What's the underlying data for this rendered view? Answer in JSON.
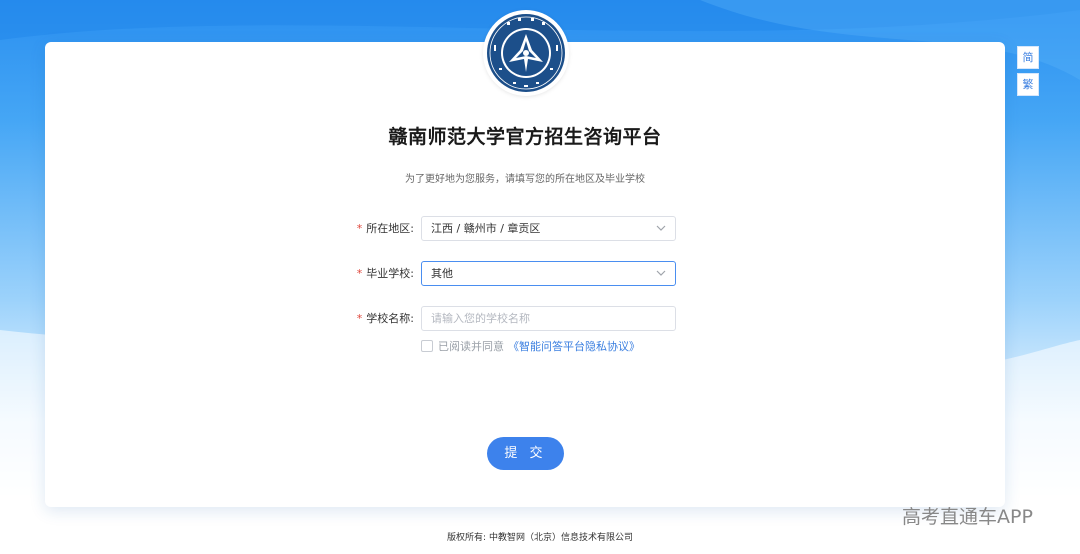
{
  "language_switch": {
    "simplified": "简",
    "traditional": "繁"
  },
  "header": {
    "logo_alt": "赣南师范大学校徽",
    "title": "赣南师范大学官方招生咨询平台",
    "subtitle": "为了更好地为您服务，请填写您的所在地区及毕业学校"
  },
  "form": {
    "required_mark": "*",
    "region": {
      "label": "所在地区:",
      "value": "江西 / 赣州市 / 章贡区"
    },
    "school": {
      "label": "毕业学校:",
      "value": "其他"
    },
    "school_name": {
      "label": "学校名称:",
      "value": "",
      "placeholder": "请输入您的学校名称"
    },
    "agreement": {
      "text": "已阅读并同意",
      "link": "《智能问答平台隐私协议》",
      "checked": false
    },
    "submit_label": "提 交"
  },
  "footer": {
    "copyright": "版权所有: 中教智网（北京）信息技术有限公司"
  },
  "watermark": "高考直通车APP",
  "colors": {
    "accent": "#3d82ec",
    "required": "#e0453a",
    "link": "#3b7fe0",
    "logo_blue": "#1c4f8a"
  }
}
